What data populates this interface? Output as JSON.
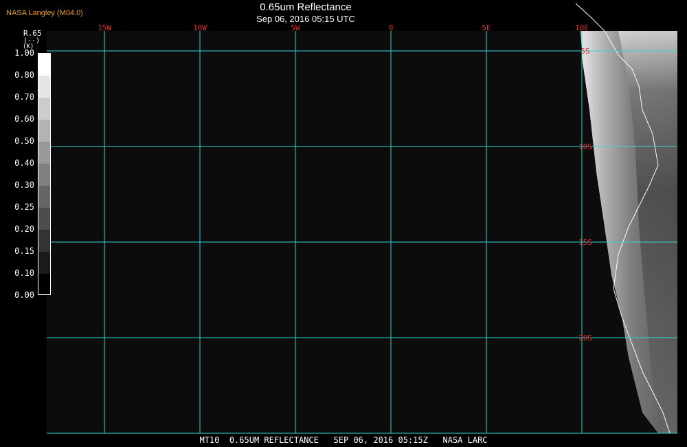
{
  "header": {
    "source": "NASA Langley (M04.0)",
    "title": "0.65um Reflectance",
    "subtitle": "Sep 06, 2016 05:15 UTC"
  },
  "legend": {
    "variable": "R.65",
    "unit": "(--)",
    "sub": "(K)",
    "ticks": [
      "1.00",
      "0.80",
      "0.70",
      "0.60",
      "0.50",
      "0.40",
      "0.30",
      "0.25",
      "0.20",
      "0.15",
      "0.10",
      "0.00"
    ]
  },
  "map": {
    "longitude_labels": [
      "15W",
      "10W",
      "5W",
      "0",
      "5E",
      "10E"
    ],
    "latitude_labels": [
      "5S",
      "10S",
      "15S",
      "20S"
    ],
    "grid_color": "#33d6d6",
    "label_color": "#e03030",
    "background_color": "#0c0c0c"
  },
  "footer": {
    "text": "MT10  0.65UM REFLECTANCE   SEP 06, 2016 05:15Z   NASA LARC"
  }
}
